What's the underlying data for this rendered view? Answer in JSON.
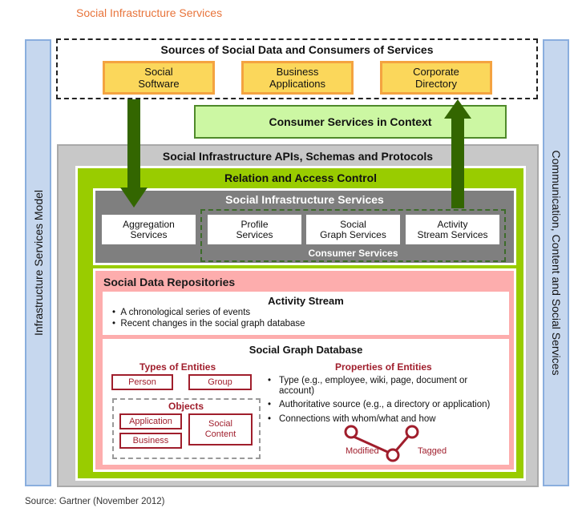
{
  "title": "Social Infrastructure Services",
  "side_left_label": "Infrastructure Services Model",
  "side_right_label": "Communication, Content and Social Services",
  "sources": {
    "heading": "Sources of Social Data and Consumers of Services",
    "items": [
      {
        "line1": "Social",
        "line2": "Software"
      },
      {
        "line1": "Business",
        "line2": "Applications"
      },
      {
        "line1": "Corporate",
        "line2": "Directory"
      }
    ]
  },
  "consumer_services_in_context": "Consumer Services in Context",
  "apis_heading": "Social Infrastructure APIs, Schemas and Protocols",
  "relation_heading": "Relation and Access Control",
  "sis": {
    "heading": "Social Infrastructure Services",
    "services": [
      {
        "line1": "Aggregation",
        "line2": "Services"
      },
      {
        "line1": "Profile",
        "line2": "Services"
      },
      {
        "line1": "Social",
        "line2": "Graph Services"
      },
      {
        "line1": "Activity",
        "line2": "Stream Services"
      }
    ],
    "consumer_label": "Consumer Services"
  },
  "repositories": {
    "heading": "Social Data Repositories",
    "activity_stream": {
      "heading": "Activity Stream",
      "bullets": [
        "A chronological series of events",
        "Recent changes in the social graph database"
      ]
    },
    "social_graph": {
      "heading": "Social Graph Database",
      "types_heading": "Types of Entities",
      "types": [
        "Person",
        "Group"
      ],
      "objects_heading": "Objects",
      "objects": [
        "Application",
        "Business",
        "Social Content"
      ],
      "properties_heading": "Properties of Entities",
      "properties": [
        "Type (e.g., employee, wiki, page, document or account)",
        "Authoritative source (e.g., a directory or application)",
        "Connections with whom/what and how"
      ],
      "graph_labels": {
        "left": "Modified",
        "right": "Tagged"
      }
    }
  },
  "footer": "Source: Gartner (November 2012)",
  "colors": {
    "title": "#e8743b",
    "side": "#c6d7ee",
    "yellow": "#fbd75b",
    "light_green": "#ccf7a3",
    "green": "#99cc00",
    "dark_green": "#336600",
    "gray": "#7f7f7f",
    "pink": "#fdadad",
    "dark_red": "#a01e2c"
  }
}
